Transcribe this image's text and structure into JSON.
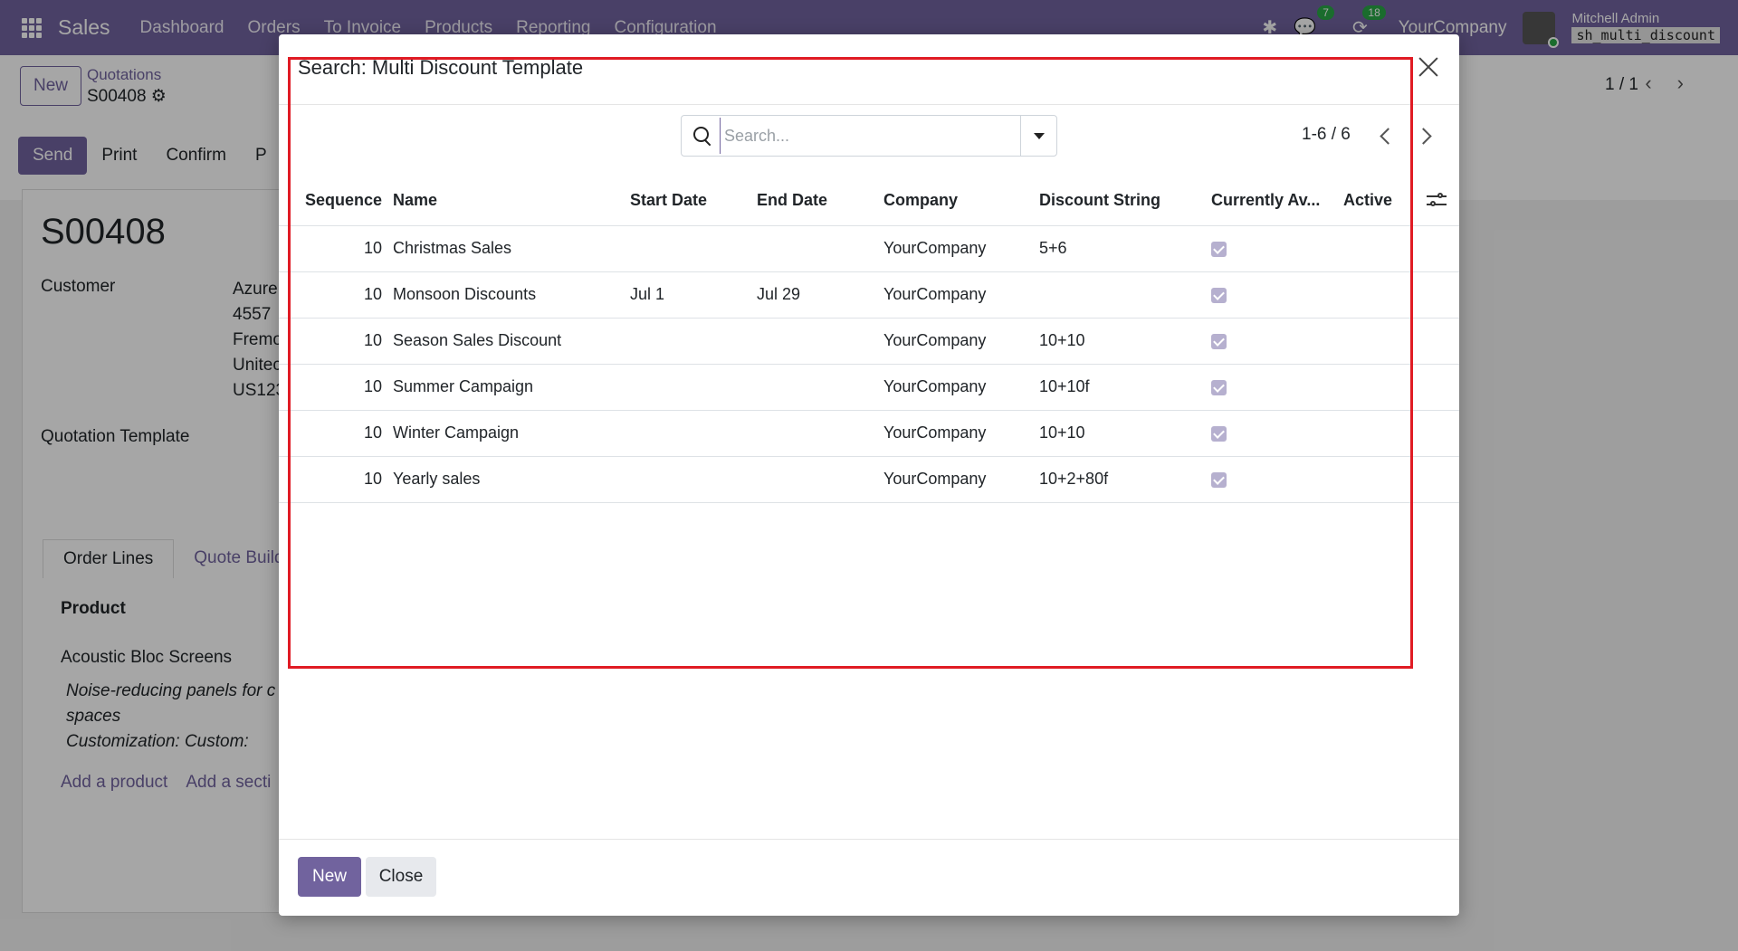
{
  "navbar": {
    "brand": "Sales",
    "menu": [
      "Dashboard",
      "Orders",
      "To Invoice",
      "Products",
      "Reporting",
      "Configuration"
    ],
    "messages_count": "7",
    "activities_count": "18",
    "company": "YourCompany",
    "user": "Mitchell Admin",
    "database": "sh_multi_discount"
  },
  "background": {
    "new_label": "New",
    "breadcrumb_parent": "Quotations",
    "breadcrumb_current": "S00408",
    "pager": "1 / 1",
    "actions": [
      "Send",
      "Print",
      "Confirm",
      "P"
    ],
    "record_title": "S00408",
    "customer_label": "Customer",
    "customer_lines": [
      "Azure",
      "4557",
      "Fremo",
      "Unitec",
      "US123"
    ],
    "quotation_template_label": "Quotation Template",
    "tabs": [
      "Order Lines",
      "Quote Build"
    ],
    "product_header": "Product",
    "product_name": "Acoustic Bloc Screens",
    "product_desc": [
      "Noise-reducing panels for c",
      "spaces",
      "Customization: Custom:"
    ],
    "add_links": "Add a product    Add a secti"
  },
  "dialog": {
    "title": "Search: Multi Discount Template",
    "search_placeholder": "Search...",
    "pager": "1-6 / 6",
    "columns": {
      "sequence": "Sequence",
      "name": "Name",
      "start_date": "Start Date",
      "end_date": "End Date",
      "company": "Company",
      "discount_string": "Discount String",
      "currently_available": "Currently Av...",
      "active": "Active"
    },
    "rows": [
      {
        "sequence": "10",
        "name": "Christmas Sales",
        "start_date": "",
        "end_date": "",
        "company": "YourCompany",
        "discount_string": "5+6",
        "available": true
      },
      {
        "sequence": "10",
        "name": "Monsoon Discounts",
        "start_date": "Jul 1",
        "end_date": "Jul 29",
        "company": "YourCompany",
        "discount_string": "",
        "available": true
      },
      {
        "sequence": "10",
        "name": "Season Sales Discount",
        "start_date": "",
        "end_date": "",
        "company": "YourCompany",
        "discount_string": "10+10",
        "available": true
      },
      {
        "sequence": "10",
        "name": "Summer Campaign",
        "start_date": "",
        "end_date": "",
        "company": "YourCompany",
        "discount_string": "10+10f",
        "available": true
      },
      {
        "sequence": "10",
        "name": "Winter Campaign",
        "start_date": "",
        "end_date": "",
        "company": "YourCompany",
        "discount_string": "10+10",
        "available": true
      },
      {
        "sequence": "10",
        "name": "Yearly sales",
        "start_date": "",
        "end_date": "",
        "company": "YourCompany",
        "discount_string": "10+2+80f",
        "available": true
      }
    ],
    "new_button": "New",
    "close_button": "Close"
  },
  "colors": {
    "brand": "#71639e",
    "highlight": "#e01b24",
    "checkbox": "#b6b0cf"
  }
}
